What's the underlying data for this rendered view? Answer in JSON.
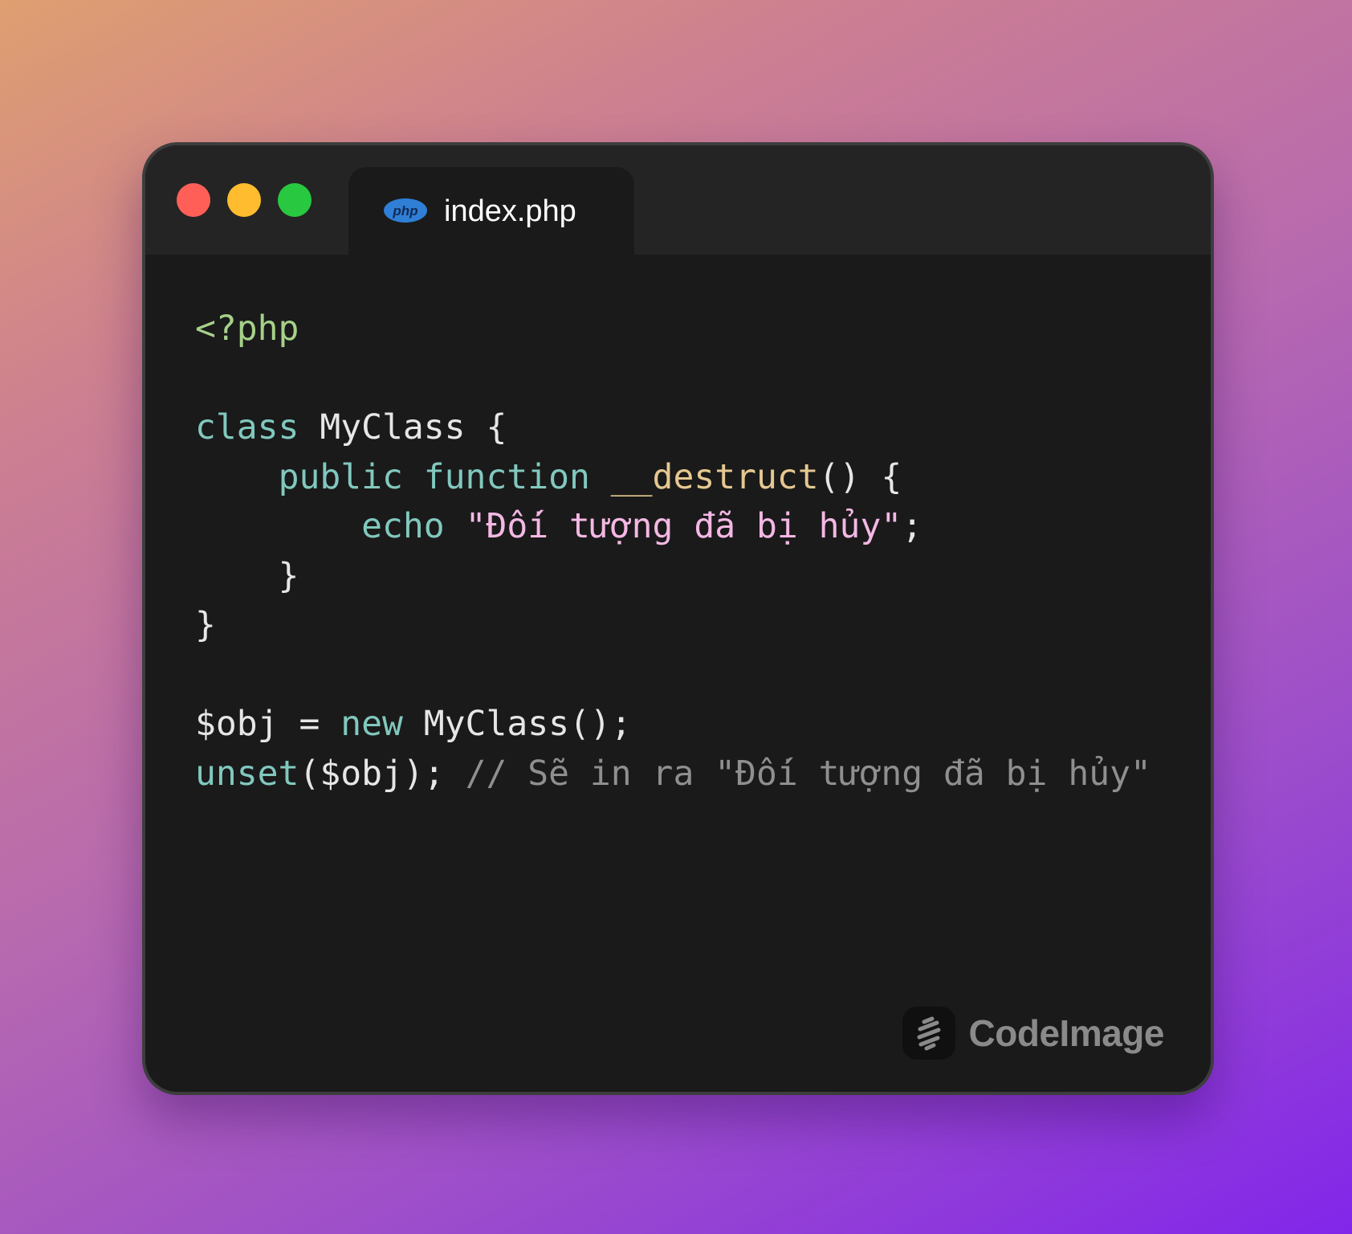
{
  "window": {
    "traffic_lights": [
      "close",
      "minimize",
      "maximize"
    ],
    "colors": {
      "close": "#ff5f57",
      "minimize": "#febc2e",
      "maximize": "#28c840"
    }
  },
  "tab": {
    "icon": "php-icon",
    "icon_text": "php",
    "label": "index.php"
  },
  "code": {
    "language": "php",
    "lines": [
      {
        "tokens": [
          {
            "t": "tag",
            "v": "<?php"
          }
        ]
      },
      {
        "tokens": []
      },
      {
        "tokens": [
          {
            "t": "kw",
            "v": "class"
          },
          {
            "t": "plain",
            "v": " MyClass {"
          }
        ]
      },
      {
        "tokens": [
          {
            "t": "plain",
            "v": "    "
          },
          {
            "t": "kw",
            "v": "public function"
          },
          {
            "t": "plain",
            "v": " "
          },
          {
            "t": "fn",
            "v": "__destruct"
          },
          {
            "t": "plain",
            "v": "() {"
          }
        ]
      },
      {
        "tokens": [
          {
            "t": "plain",
            "v": "        "
          },
          {
            "t": "kw",
            "v": "echo"
          },
          {
            "t": "plain",
            "v": " "
          },
          {
            "t": "str",
            "v": "\"Đối tượng đã bị hủy\""
          },
          {
            "t": "plain",
            "v": ";"
          }
        ]
      },
      {
        "tokens": [
          {
            "t": "plain",
            "v": "    }"
          }
        ]
      },
      {
        "tokens": [
          {
            "t": "plain",
            "v": "}"
          }
        ]
      },
      {
        "tokens": []
      },
      {
        "tokens": [
          {
            "t": "plain",
            "v": "$obj = "
          },
          {
            "t": "kw",
            "v": "new"
          },
          {
            "t": "plain",
            "v": " MyClass();"
          }
        ]
      },
      {
        "tokens": [
          {
            "t": "kw",
            "v": "unset"
          },
          {
            "t": "plain",
            "v": "($obj); "
          },
          {
            "t": "cm",
            "v": "// Sẽ in ra \"Đối tượng đã bị hủy\""
          }
        ]
      }
    ]
  },
  "branding": {
    "icon": "codeimage-logo-icon",
    "label": "CodeImage"
  }
}
